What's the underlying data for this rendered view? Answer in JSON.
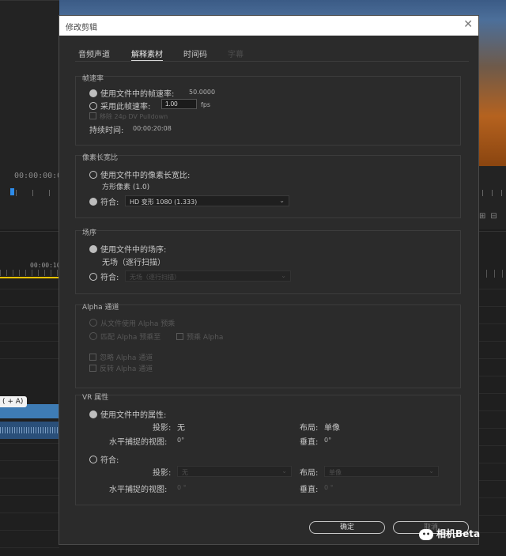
{
  "background": {
    "timecode_left": "00:00:00:0",
    "timecode_mid": "00:00:10",
    "clip_label": "( + A)"
  },
  "dialog": {
    "title": "修改剪辑",
    "close": "✕",
    "tabs": [
      {
        "label": "音频声道"
      },
      {
        "label": "解释素材"
      },
      {
        "label": "时间码"
      },
      {
        "label": "字幕"
      }
    ],
    "frame_rate": {
      "title": "帧速率",
      "use_file": "使用文件中的帧速率:",
      "file_value": "50.0000",
      "assume": "采用此帧速率:",
      "assume_value": "1.00",
      "unit": "fps",
      "pulldown": "移除 24p DV Pulldown",
      "duration_label": "持续时间:",
      "duration_value": "00:00:20:08"
    },
    "pixel_aspect": {
      "title": "像素长宽比",
      "use_file": "使用文件中的像素长宽比:",
      "file_value": "方形像素 (1.0)",
      "conform": "符合:",
      "conform_value": "HD 变形 1080 (1.333)"
    },
    "field_order": {
      "title": "场序",
      "use_file": "使用文件中的场序:",
      "file_value": "无场（逐行扫描）",
      "conform": "符合:",
      "conform_value": "无场（逐行扫描）"
    },
    "alpha": {
      "title": "Alpha 通道",
      "from_file": "从文件使用 Alpha 预乘",
      "match": "匹配 Alpha 预乘至",
      "premultiply": "预乘 Alpha",
      "ignore": "忽略 Alpha 通道",
      "invert": "反转 Alpha 通道"
    },
    "vr": {
      "title": "VR 属性",
      "use_file": "使用文件中的属性:",
      "projection_label": "投影:",
      "projection_value": "无",
      "layout_label": "布局:",
      "layout_value": "单像",
      "hview_label": "水平捕捉的视图:",
      "hview_value": "0°",
      "vertical_label": "垂直:",
      "vertical_value": "0°",
      "conform": "符合:",
      "c_projection_value": "无",
      "c_layout_value": "单像",
      "c_hview_value": "0 °",
      "c_vertical_value": "0 °"
    },
    "buttons": {
      "ok": "确定",
      "cancel": "取消"
    }
  },
  "watermark": {
    "text": "相机Beta"
  }
}
